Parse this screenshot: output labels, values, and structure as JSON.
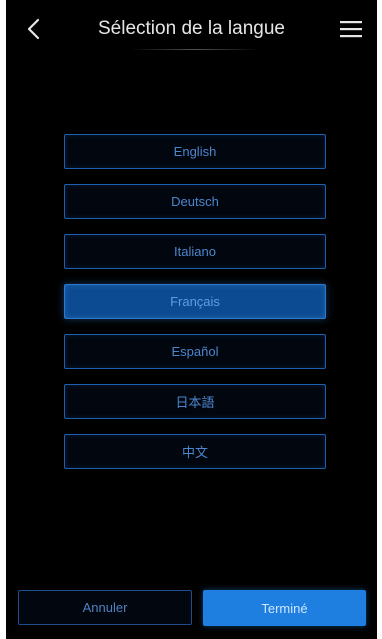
{
  "header": {
    "title": "Sélection de la langue",
    "back_icon": "chevron-left-icon",
    "menu_icon": "hamburger-menu-icon"
  },
  "languages": [
    {
      "label": "English",
      "selected": false
    },
    {
      "label": "Deutsch",
      "selected": false
    },
    {
      "label": "Italiano",
      "selected": false
    },
    {
      "label": "Français",
      "selected": true
    },
    {
      "label": "Español",
      "selected": false
    },
    {
      "label": "日本語",
      "selected": false
    },
    {
      "label": "中文",
      "selected": false
    }
  ],
  "footer": {
    "cancel_label": "Annuler",
    "done_label": "Terminé"
  },
  "colors": {
    "background": "#000000",
    "accent": "#1e7fe0",
    "button_border": "#1d5fae",
    "selected_fill": "#0c4b92"
  }
}
